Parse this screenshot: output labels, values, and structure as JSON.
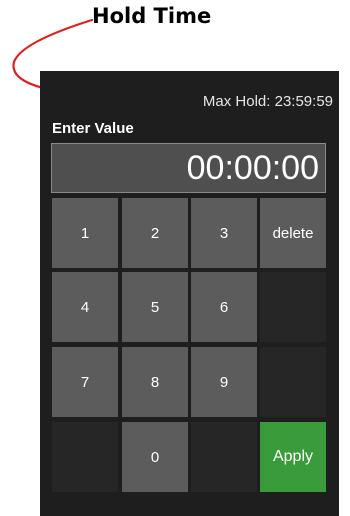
{
  "annotation": {
    "title": "Hold Time",
    "arrow_color": "#e02020"
  },
  "panel": {
    "max_hold_label": "Max Hold: 23:59:59",
    "enter_label": "Enter Value",
    "display_value": "00:00:00"
  },
  "keypad": {
    "k1": "1",
    "k2": "2",
    "k3": "3",
    "delete": "delete",
    "k4": "4",
    "k5": "5",
    "k6": "6",
    "k7": "7",
    "k8": "8",
    "k9": "9",
    "k0": "0",
    "apply": "Apply"
  },
  "colors": {
    "panel_bg": "#1e1e1e",
    "key_bg": "#5c5c5c",
    "blank_key_bg": "#262626",
    "apply_bg": "#3a9b3a",
    "display_bg": "#4f4f4f"
  }
}
